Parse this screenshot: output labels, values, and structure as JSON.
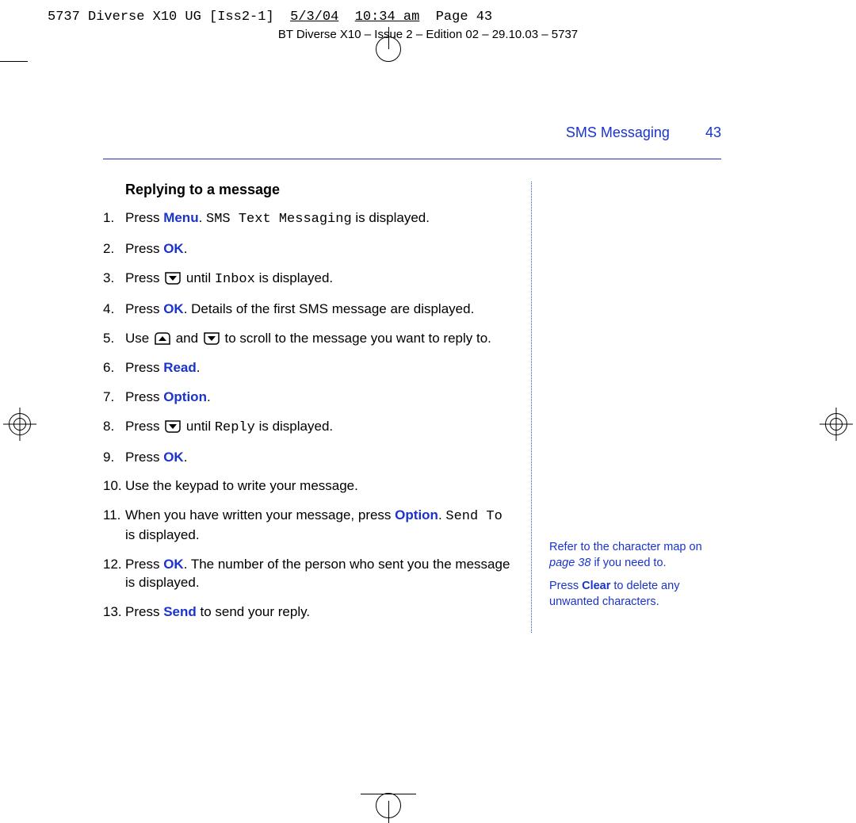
{
  "prepress": {
    "doc": "5737 Diverse X10 UG [Iss2-1]",
    "date": "5/3/04",
    "time": "10:34 am",
    "page": "Page 43"
  },
  "doc_header": "BT Diverse X10 – Issue 2 – Edition 02 – 29.10.03 – 5737",
  "header": {
    "section": "SMS Messaging",
    "page_number": "43"
  },
  "body": {
    "heading": "Replying to a message",
    "steps": [
      {
        "n": "1.",
        "pre": "Press ",
        "key": "Menu",
        "post": ". ",
        "lcd": "SMS Text Messaging",
        "tail": " is displayed."
      },
      {
        "n": "2.",
        "pre": "Press ",
        "key": "OK",
        "post": "."
      },
      {
        "n": "3.",
        "pre": "Press ",
        "icons": [
          "down"
        ],
        "mid": " until ",
        "lcd": "Inbox",
        "tail": " is displayed."
      },
      {
        "n": "4.",
        "pre": "Press ",
        "key": "OK",
        "post": ". Details of the first SMS message are displayed."
      },
      {
        "n": "5.",
        "pre": "Use ",
        "icons": [
          "up",
          "and",
          "down"
        ],
        "mid": " to scroll to the message you want to reply to."
      },
      {
        "n": "6.",
        "pre": "Press ",
        "key": "Read",
        "post": "."
      },
      {
        "n": "7.",
        "pre": "Press ",
        "key": "Option",
        "post": "."
      },
      {
        "n": "8.",
        "pre": "Press ",
        "icons": [
          "down"
        ],
        "mid": " until ",
        "lcd": "Reply",
        "tail": " is displayed."
      },
      {
        "n": "9.",
        "pre": "Press ",
        "key": "OK",
        "post": "."
      },
      {
        "n": "10.",
        "pre": "Use the keypad to write your message."
      },
      {
        "n": "11.",
        "pre": "When you have written your message, press ",
        "key": "Option",
        "post": ". ",
        "lcd": "Send To",
        "tail": " is displayed."
      },
      {
        "n": "12.",
        "pre": "Press ",
        "key": "OK",
        "post": ". The number of the person who sent you the message is displayed."
      },
      {
        "n": "13.",
        "pre": "Press ",
        "key": "Send",
        "post": " to send your reply."
      }
    ]
  },
  "sidebar": {
    "p1_a": "Refer to the character map on ",
    "p1_link": "page 38",
    "p1_b": " if you need to.",
    "p2_a": "Press ",
    "p2_key": "Clear",
    "p2_b": " to delete any unwanted characters."
  },
  "word_and": "and"
}
